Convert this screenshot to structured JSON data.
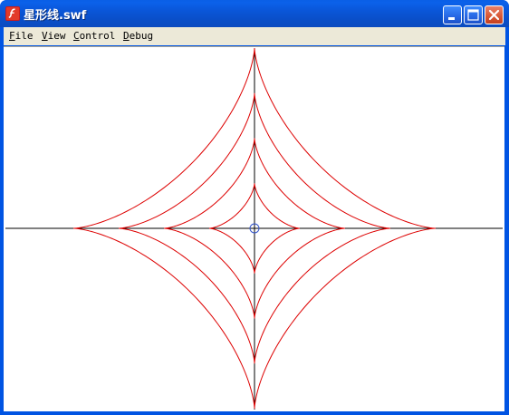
{
  "window": {
    "title": "星形线.swf",
    "icons": {
      "app": "flash-player-icon",
      "minimize": "minimize-icon",
      "maximize": "maximize-icon",
      "close": "close-icon"
    }
  },
  "menu": [
    {
      "accel": "F",
      "rest": "ile"
    },
    {
      "accel": "V",
      "rest": "iew"
    },
    {
      "accel": "C",
      "rest": "ontrol"
    },
    {
      "accel": "D",
      "rest": "ebug"
    }
  ],
  "canvas": {
    "curve_color": "#dd0000",
    "axis_color": "#000000",
    "marker_color": "#3355cc",
    "astroid_scales": [
      1,
      0.75,
      0.5,
      0.25
    ]
  }
}
